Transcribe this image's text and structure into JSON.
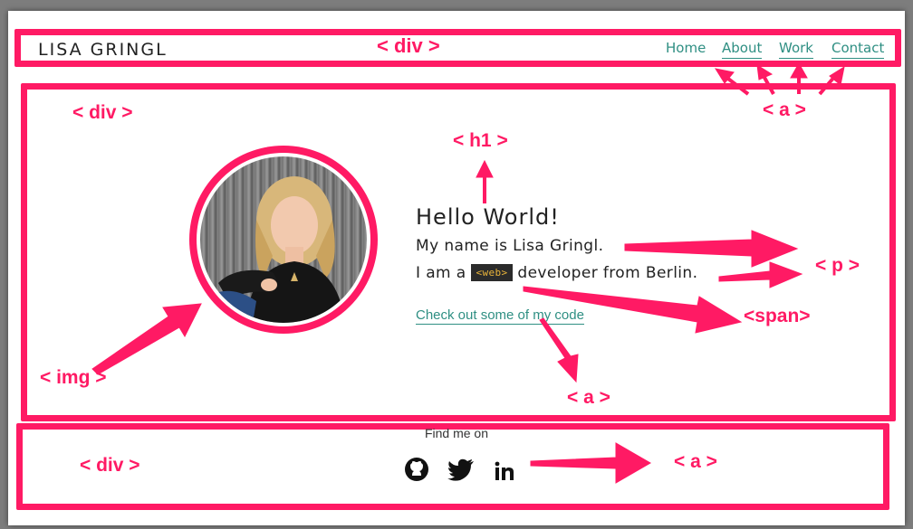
{
  "header": {
    "brand": "LISA GRINGL",
    "nav": [
      {
        "label": "Home"
      },
      {
        "label": "About"
      },
      {
        "label": "Work"
      },
      {
        "label": "Contact"
      }
    ]
  },
  "hero": {
    "heading": "Hello World!",
    "line1": "My name is Lisa Gringl.",
    "line2_prefix": "I am a",
    "span_text": "<web>",
    "line2_suffix": "developer from Berlin.",
    "code_link": "Check out some of my code"
  },
  "footer": {
    "find_text": "Find me on",
    "social": [
      {
        "icon": "github-icon"
      },
      {
        "icon": "twitter-icon"
      },
      {
        "icon": "linkedin-icon"
      }
    ]
  },
  "annotations": {
    "header_div": "< div >",
    "main_div": "< div >",
    "footer_div": "< div >",
    "h1": "< h1 >",
    "a_nav": "< a >",
    "p": "< p >",
    "span": "<span>",
    "img": "< img >",
    "a_link": "< a >",
    "a_social": "< a >"
  },
  "colors": {
    "annotation": "#ff1a64",
    "link": "#2f8f83",
    "background": "#7d7d7d"
  }
}
